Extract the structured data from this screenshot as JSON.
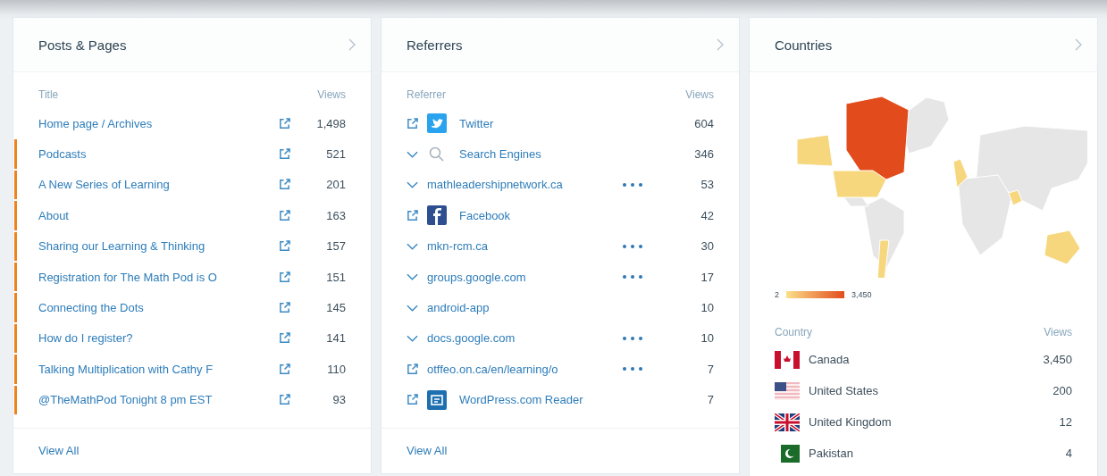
{
  "posts": {
    "title": "Posts & Pages",
    "columns": [
      "Title",
      "Views"
    ],
    "rows": [
      {
        "title": "Home page / Archives",
        "views": "1,498",
        "marked": false
      },
      {
        "title": "Podcasts",
        "views": "521",
        "marked": true
      },
      {
        "title": "A New Series of Learning",
        "views": "201",
        "marked": true
      },
      {
        "title": "About",
        "views": "163",
        "marked": true
      },
      {
        "title": "Sharing our Learning & Thinking",
        "views": "157",
        "marked": true
      },
      {
        "title": "Registration for The Math Pod is O",
        "views": "151",
        "marked": true
      },
      {
        "title": "Connecting the Dots",
        "views": "145",
        "marked": true
      },
      {
        "title": "How do I register?",
        "views": "141",
        "marked": true
      },
      {
        "title": "Talking Multiplication with Cathy F",
        "views": "110",
        "marked": true
      },
      {
        "title": "@TheMathPod Tonight 8 pm EST",
        "views": "93",
        "marked": true
      }
    ],
    "footer": "View All"
  },
  "referrers": {
    "title": "Referrers",
    "columns": [
      "Referrer",
      "Views"
    ],
    "rows": [
      {
        "kind": "link",
        "name": "Twitter",
        "views": "604",
        "more": false
      },
      {
        "kind": "expand",
        "name": "Search Engines",
        "views": "346",
        "more": false
      },
      {
        "kind": "expand",
        "name": "mathleadershipnetwork.ca",
        "views": "53",
        "more": true
      },
      {
        "kind": "link",
        "name": "Facebook",
        "views": "42",
        "more": false
      },
      {
        "kind": "expand",
        "name": "mkn-rcm.ca",
        "views": "30",
        "more": true
      },
      {
        "kind": "expand",
        "name": "groups.google.com",
        "views": "17",
        "more": true
      },
      {
        "kind": "expand",
        "name": "android-app",
        "views": "10",
        "more": false
      },
      {
        "kind": "expand",
        "name": "docs.google.com",
        "views": "10",
        "more": true
      },
      {
        "kind": "link",
        "name": "otffeo.on.ca/en/learning/o",
        "views": "7",
        "more": true
      },
      {
        "kind": "link",
        "name": "WordPress.com Reader",
        "views": "7",
        "more": false
      }
    ],
    "footer": "View All"
  },
  "countries": {
    "title": "Countries",
    "legend": {
      "min": "2",
      "max": "3,450"
    },
    "columns": [
      "Country",
      "Views"
    ],
    "rows": [
      {
        "name": "Canada",
        "views": "3,450"
      },
      {
        "name": "United States",
        "views": "200"
      },
      {
        "name": "United Kingdom",
        "views": "12"
      },
      {
        "name": "Pakistan",
        "views": "4"
      }
    ]
  }
}
